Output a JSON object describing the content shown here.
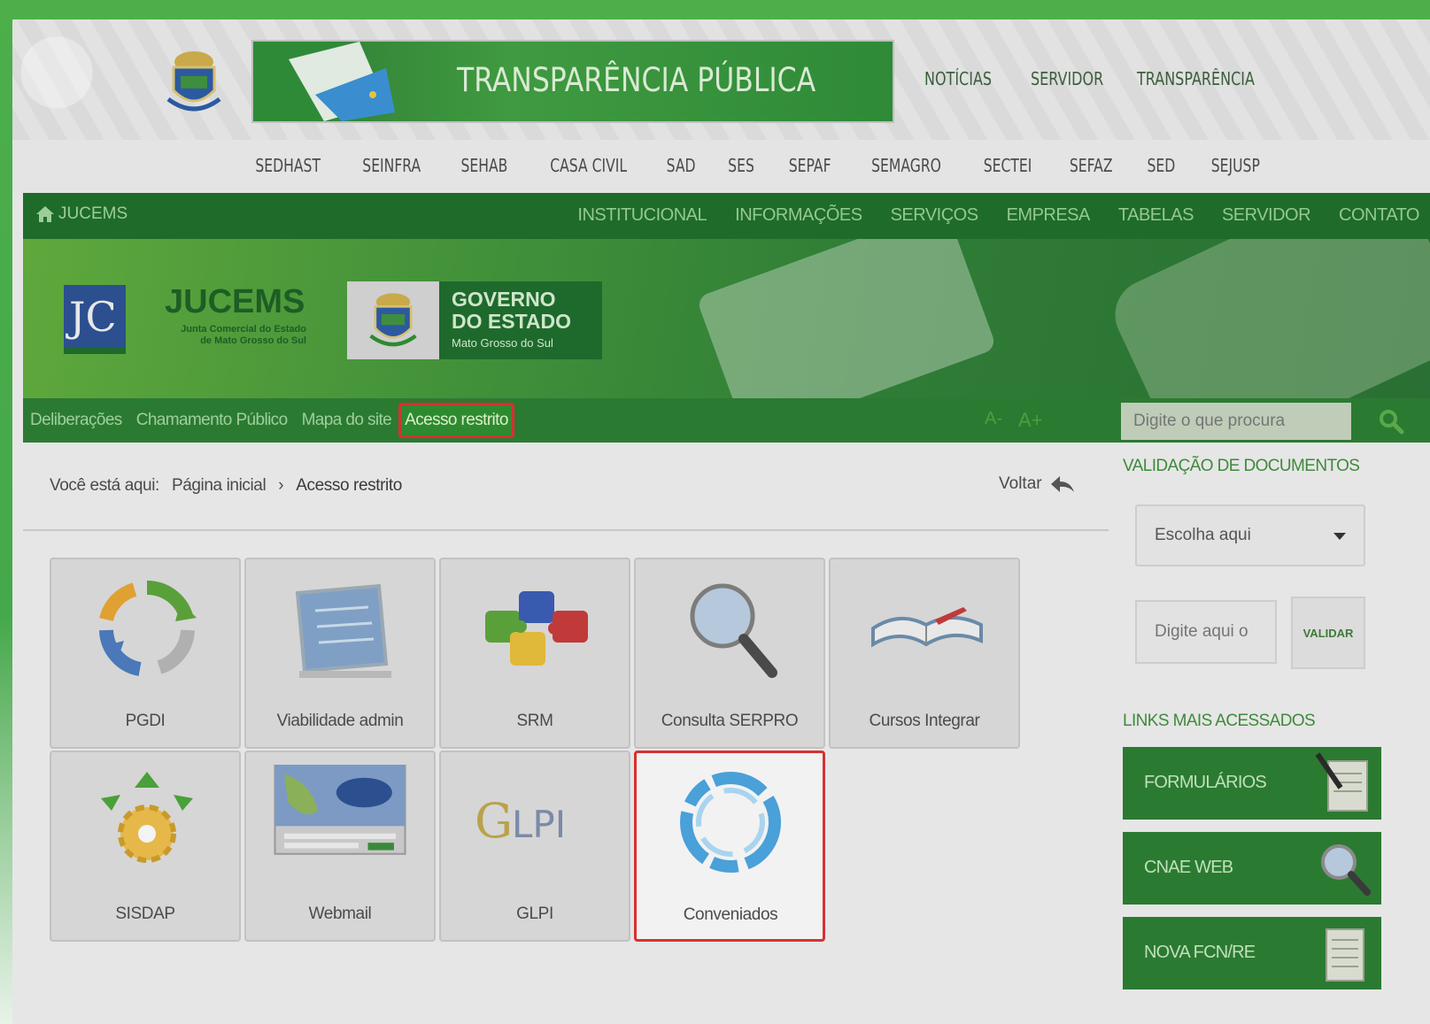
{
  "top_header": {
    "banner_title": "TRANSPARÊNCIA PÚBLICA",
    "links": [
      "NOTÍCIAS",
      "SERVIDOR",
      "TRANSPARÊNCIA"
    ]
  },
  "secretarias": [
    "SEDHAST",
    "SEINFRA",
    "SEHAB",
    "CASA CIVIL",
    "SAD",
    "SES",
    "SEPAF",
    "SEMAGRO",
    "SECTEI",
    "SEFAZ",
    "SED",
    "SEJUSP"
  ],
  "main_nav": {
    "home_label": "JUCEMS",
    "items": [
      "INSTITUCIONAL",
      "INFORMAÇÕES",
      "SERVIÇOS",
      "EMPRESA",
      "TABELAS",
      "SERVIDOR",
      "CONTATO"
    ]
  },
  "hero": {
    "jucems_title": "JUCEMS",
    "jucems_subtitle_1": "Junta Comercial do Estado",
    "jucems_subtitle_2": "de Mato Grosso do Sul",
    "gov_line1": "GOVERNO",
    "gov_line2": "DO ESTADO",
    "gov_line3": "Mato Grosso do Sul"
  },
  "sub_nav": {
    "links": [
      "Deliberações",
      "Chamamento Público",
      "Mapa do site"
    ],
    "active_link": "Acesso restrito",
    "font_decrease": "A-",
    "font_increase": "A+",
    "search_placeholder": "Digite o que procura"
  },
  "breadcrumb": {
    "prefix": "Você está aqui:",
    "home": "Página inicial",
    "separator": "›",
    "current": "Acesso restrito"
  },
  "voltar_label": "Voltar",
  "tiles": [
    {
      "label": "PGDI",
      "icon": "recycle-arrows-icon"
    },
    {
      "label": "Viabilidade admin",
      "icon": "checklist-monitor-icon"
    },
    {
      "label": "SRM",
      "icon": "puzzle-pieces-icon"
    },
    {
      "label": "Consulta SERPRO",
      "icon": "magnifier-icon"
    },
    {
      "label": "Cursos Integrar",
      "icon": "open-book-icon"
    },
    {
      "label": "SISDAP",
      "icon": "gear-arrows-icon"
    },
    {
      "label": "Webmail",
      "icon": "map-screenshot-icon"
    },
    {
      "label": "GLPI",
      "icon": "glpi-logo-icon"
    },
    {
      "label": "Conveniados",
      "icon": "blue-ring-icon"
    }
  ],
  "sidebar": {
    "validation_title": "VALIDAÇÃO DE DOCUMENTOS",
    "select_value": "Escolha aqui",
    "code_placeholder": "Digite aqui o",
    "validar_label": "VALIDAR",
    "links_title": "LINKS MAIS ACESSADOS",
    "quick_links": [
      "FORMULÁRIOS",
      "CNAE WEB",
      "NOVA FCN/RE"
    ]
  },
  "colors": {
    "nav_green": "#1f6b2a",
    "subnav_green": "#2b7a32",
    "highlight_red": "#d83030",
    "outer_green": "#4caf4a"
  }
}
